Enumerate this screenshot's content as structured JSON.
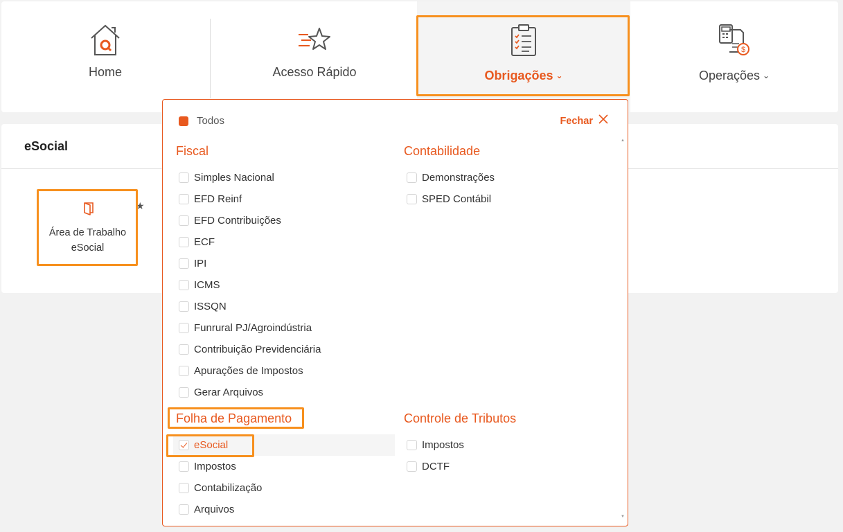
{
  "nav": {
    "home": "Home",
    "quick": "Acesso Rápido",
    "obrigacoes": "Obrigações",
    "operacoes": "Operações",
    "chevron": "⌄",
    "accent": "#e8591f",
    "icons": {
      "home": "home-icon",
      "quick": "star-icon",
      "obrigacoes": "clipboard-checklist-icon",
      "operacoes": "calculator-invoice-icon"
    }
  },
  "esocial_panel": {
    "title": "eSocial",
    "tile_label": "Área de Trabalho eSocial",
    "star": "★"
  },
  "dropdown": {
    "todos": "Todos",
    "fechar": "Fechar",
    "fiscal": {
      "title": "Fiscal",
      "items": [
        "Simples Nacional",
        "EFD Reinf",
        "EFD Contribuições",
        "ECF",
        "IPI",
        "ICMS",
        "ISSQN",
        "Funrural PJ/Agroindústria",
        "Contribuição Previdenciária",
        "Apurações de Impostos",
        "Gerar Arquivos"
      ]
    },
    "contabilidade": {
      "title": "Contabilidade",
      "items": [
        "Demonstrações",
        "SPED Contábil"
      ]
    },
    "folha": {
      "title": "Folha de Pagamento",
      "items": [
        "eSocial",
        "Impostos",
        "Contabilização",
        "Arquivos"
      ],
      "selected": "eSocial"
    },
    "controle": {
      "title": "Controle de Tributos",
      "items": [
        "Impostos",
        "DCTF"
      ]
    }
  }
}
